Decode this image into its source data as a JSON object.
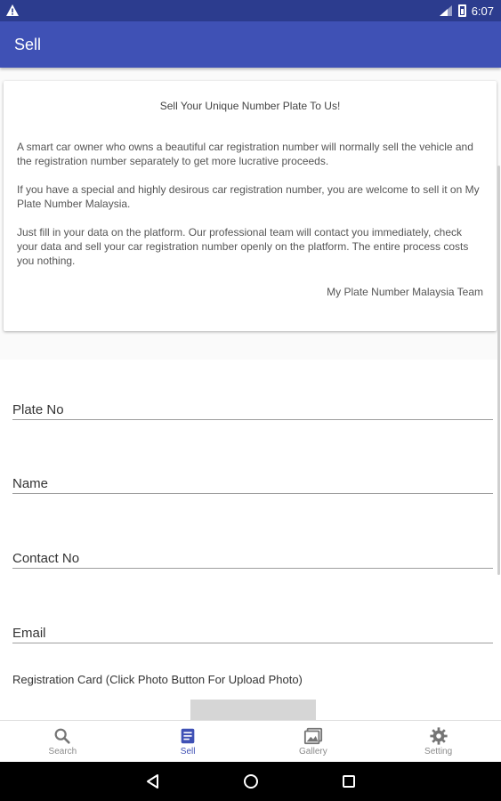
{
  "status_bar": {
    "time": "6:07",
    "icons": [
      "warning-icon",
      "signal-icon",
      "battery-icon"
    ]
  },
  "app_bar": {
    "title": "Sell"
  },
  "info_card": {
    "title": "Sell Your Unique Number Plate To Us!",
    "paragraphs": [
      "A smart car owner who owns a beautiful car registration number will normally sell the vehicle and the registration number separately to get more lucrative proceeds.",
      "If you have a special and highly desirous car registration number, you are welcome to sell it on My Plate Number Malaysia.",
      "Just fill in your data on the platform. Our professional team will contact you immediately, check your data and sell your car registration number openly on the platform. The entire process costs you nothing."
    ],
    "signature": "My Plate Number Malaysia Team"
  },
  "form": {
    "plate_no_placeholder": "Plate No",
    "name_placeholder": "Name",
    "contact_no_placeholder": "Contact No",
    "email_placeholder": "Email",
    "registration_card_label": "Registration Card (Click Photo Button For Upload Photo)"
  },
  "bottom_nav": {
    "items": [
      {
        "label": "Search",
        "icon": "search-icon",
        "active": false
      },
      {
        "label": "Sell",
        "icon": "document-icon",
        "active": true
      },
      {
        "label": "Gallery",
        "icon": "gallery-icon",
        "active": false
      },
      {
        "label": "Setting",
        "icon": "gear-icon",
        "active": false
      }
    ]
  },
  "colors": {
    "status_bar": "#2c3c8e",
    "app_bar": "#3f51b5",
    "active_tab": "#3f51b5",
    "inactive_tab": "#8a8a8a"
  }
}
